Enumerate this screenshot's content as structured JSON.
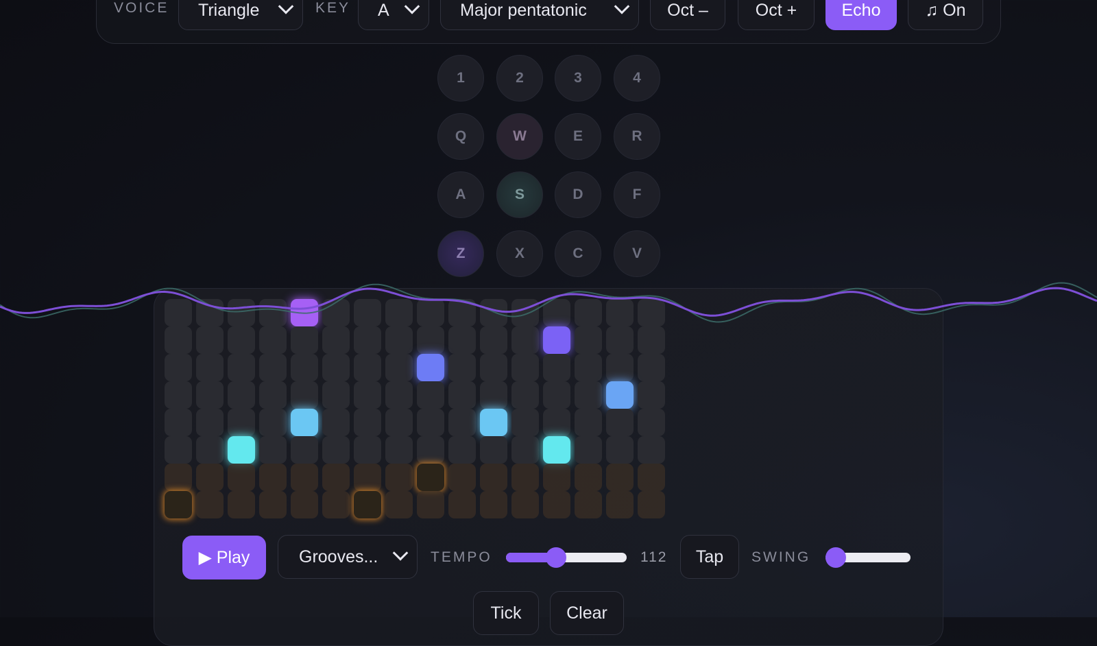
{
  "toolbar": {
    "voice_label": "VOICE",
    "voice_value": "Triangle",
    "key_label": "KEY",
    "key_value": "A",
    "scale_value": "Major pentatonic",
    "oct_down_label": "Oct –",
    "oct_up_label": "Oct +",
    "echo_label": "Echo",
    "sound_label": "♫ On"
  },
  "keypad": {
    "rows": [
      [
        "1",
        "2",
        "3",
        "4"
      ],
      [
        "Q",
        "W",
        "E",
        "R"
      ],
      [
        "A",
        "S",
        "D",
        "F"
      ],
      [
        "Z",
        "X",
        "C",
        "V"
      ]
    ]
  },
  "sequencer": {
    "columns": 16,
    "rows": 8,
    "active_notes": [
      {
        "col": 4,
        "row": 0,
        "color": "#a660f5"
      },
      {
        "col": 12,
        "row": 1,
        "color": "#7b62f5"
      },
      {
        "col": 8,
        "row": 2,
        "color": "#6d7cf5"
      },
      {
        "col": 14,
        "row": 3,
        "color": "#6aa5f4"
      },
      {
        "col": 4,
        "row": 4,
        "color": "#6bc7f3"
      },
      {
        "col": 10,
        "row": 4,
        "color": "#6bc7f3"
      },
      {
        "col": 2,
        "row": 5,
        "color": "#63e8ee"
      },
      {
        "col": 12,
        "row": 5,
        "color": "#63e8ee"
      }
    ],
    "drum_hits": [
      {
        "col": 8,
        "row": 6
      },
      {
        "col": 0,
        "row": 7
      },
      {
        "col": 6,
        "row": 7
      }
    ]
  },
  "transport": {
    "play_label": "▶ Play",
    "groove_value": "Grooves...",
    "tempo_label": "TEMPO",
    "tempo_value": "112",
    "tempo_fraction": 0.4,
    "tap_label": "Tap",
    "swing_label": "SWING",
    "swing_fraction": 0.0,
    "tick_label": "Tick",
    "clear_label": "Clear"
  },
  "colors": {
    "accent": "#8b5cf6"
  }
}
